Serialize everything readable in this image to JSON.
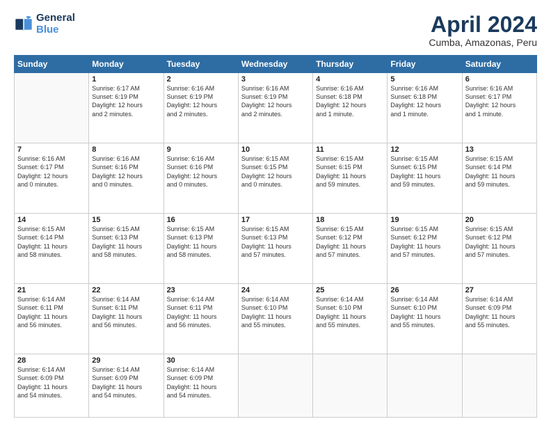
{
  "header": {
    "logo_line1": "General",
    "logo_line2": "Blue",
    "title": "April 2024",
    "subtitle": "Cumba, Amazonas, Peru"
  },
  "weekdays": [
    "Sunday",
    "Monday",
    "Tuesday",
    "Wednesday",
    "Thursday",
    "Friday",
    "Saturday"
  ],
  "weeks": [
    [
      {
        "day": "",
        "info": ""
      },
      {
        "day": "1",
        "info": "Sunrise: 6:17 AM\nSunset: 6:19 PM\nDaylight: 12 hours\nand 2 minutes."
      },
      {
        "day": "2",
        "info": "Sunrise: 6:16 AM\nSunset: 6:19 PM\nDaylight: 12 hours\nand 2 minutes."
      },
      {
        "day": "3",
        "info": "Sunrise: 6:16 AM\nSunset: 6:19 PM\nDaylight: 12 hours\nand 2 minutes."
      },
      {
        "day": "4",
        "info": "Sunrise: 6:16 AM\nSunset: 6:18 PM\nDaylight: 12 hours\nand 1 minute."
      },
      {
        "day": "5",
        "info": "Sunrise: 6:16 AM\nSunset: 6:18 PM\nDaylight: 12 hours\nand 1 minute."
      },
      {
        "day": "6",
        "info": "Sunrise: 6:16 AM\nSunset: 6:17 PM\nDaylight: 12 hours\nand 1 minute."
      }
    ],
    [
      {
        "day": "7",
        "info": "Sunrise: 6:16 AM\nSunset: 6:17 PM\nDaylight: 12 hours\nand 0 minutes."
      },
      {
        "day": "8",
        "info": "Sunrise: 6:16 AM\nSunset: 6:16 PM\nDaylight: 12 hours\nand 0 minutes."
      },
      {
        "day": "9",
        "info": "Sunrise: 6:16 AM\nSunset: 6:16 PM\nDaylight: 12 hours\nand 0 minutes."
      },
      {
        "day": "10",
        "info": "Sunrise: 6:15 AM\nSunset: 6:15 PM\nDaylight: 12 hours\nand 0 minutes."
      },
      {
        "day": "11",
        "info": "Sunrise: 6:15 AM\nSunset: 6:15 PM\nDaylight: 11 hours\nand 59 minutes."
      },
      {
        "day": "12",
        "info": "Sunrise: 6:15 AM\nSunset: 6:15 PM\nDaylight: 11 hours\nand 59 minutes."
      },
      {
        "day": "13",
        "info": "Sunrise: 6:15 AM\nSunset: 6:14 PM\nDaylight: 11 hours\nand 59 minutes."
      }
    ],
    [
      {
        "day": "14",
        "info": "Sunrise: 6:15 AM\nSunset: 6:14 PM\nDaylight: 11 hours\nand 58 minutes."
      },
      {
        "day": "15",
        "info": "Sunrise: 6:15 AM\nSunset: 6:13 PM\nDaylight: 11 hours\nand 58 minutes."
      },
      {
        "day": "16",
        "info": "Sunrise: 6:15 AM\nSunset: 6:13 PM\nDaylight: 11 hours\nand 58 minutes."
      },
      {
        "day": "17",
        "info": "Sunrise: 6:15 AM\nSunset: 6:13 PM\nDaylight: 11 hours\nand 57 minutes."
      },
      {
        "day": "18",
        "info": "Sunrise: 6:15 AM\nSunset: 6:12 PM\nDaylight: 11 hours\nand 57 minutes."
      },
      {
        "day": "19",
        "info": "Sunrise: 6:15 AM\nSunset: 6:12 PM\nDaylight: 11 hours\nand 57 minutes."
      },
      {
        "day": "20",
        "info": "Sunrise: 6:15 AM\nSunset: 6:12 PM\nDaylight: 11 hours\nand 57 minutes."
      }
    ],
    [
      {
        "day": "21",
        "info": "Sunrise: 6:14 AM\nSunset: 6:11 PM\nDaylight: 11 hours\nand 56 minutes."
      },
      {
        "day": "22",
        "info": "Sunrise: 6:14 AM\nSunset: 6:11 PM\nDaylight: 11 hours\nand 56 minutes."
      },
      {
        "day": "23",
        "info": "Sunrise: 6:14 AM\nSunset: 6:11 PM\nDaylight: 11 hours\nand 56 minutes."
      },
      {
        "day": "24",
        "info": "Sunrise: 6:14 AM\nSunset: 6:10 PM\nDaylight: 11 hours\nand 55 minutes."
      },
      {
        "day": "25",
        "info": "Sunrise: 6:14 AM\nSunset: 6:10 PM\nDaylight: 11 hours\nand 55 minutes."
      },
      {
        "day": "26",
        "info": "Sunrise: 6:14 AM\nSunset: 6:10 PM\nDaylight: 11 hours\nand 55 minutes."
      },
      {
        "day": "27",
        "info": "Sunrise: 6:14 AM\nSunset: 6:09 PM\nDaylight: 11 hours\nand 55 minutes."
      }
    ],
    [
      {
        "day": "28",
        "info": "Sunrise: 6:14 AM\nSunset: 6:09 PM\nDaylight: 11 hours\nand 54 minutes."
      },
      {
        "day": "29",
        "info": "Sunrise: 6:14 AM\nSunset: 6:09 PM\nDaylight: 11 hours\nand 54 minutes."
      },
      {
        "day": "30",
        "info": "Sunrise: 6:14 AM\nSunset: 6:09 PM\nDaylight: 11 hours\nand 54 minutes."
      },
      {
        "day": "",
        "info": ""
      },
      {
        "day": "",
        "info": ""
      },
      {
        "day": "",
        "info": ""
      },
      {
        "day": "",
        "info": ""
      }
    ]
  ]
}
